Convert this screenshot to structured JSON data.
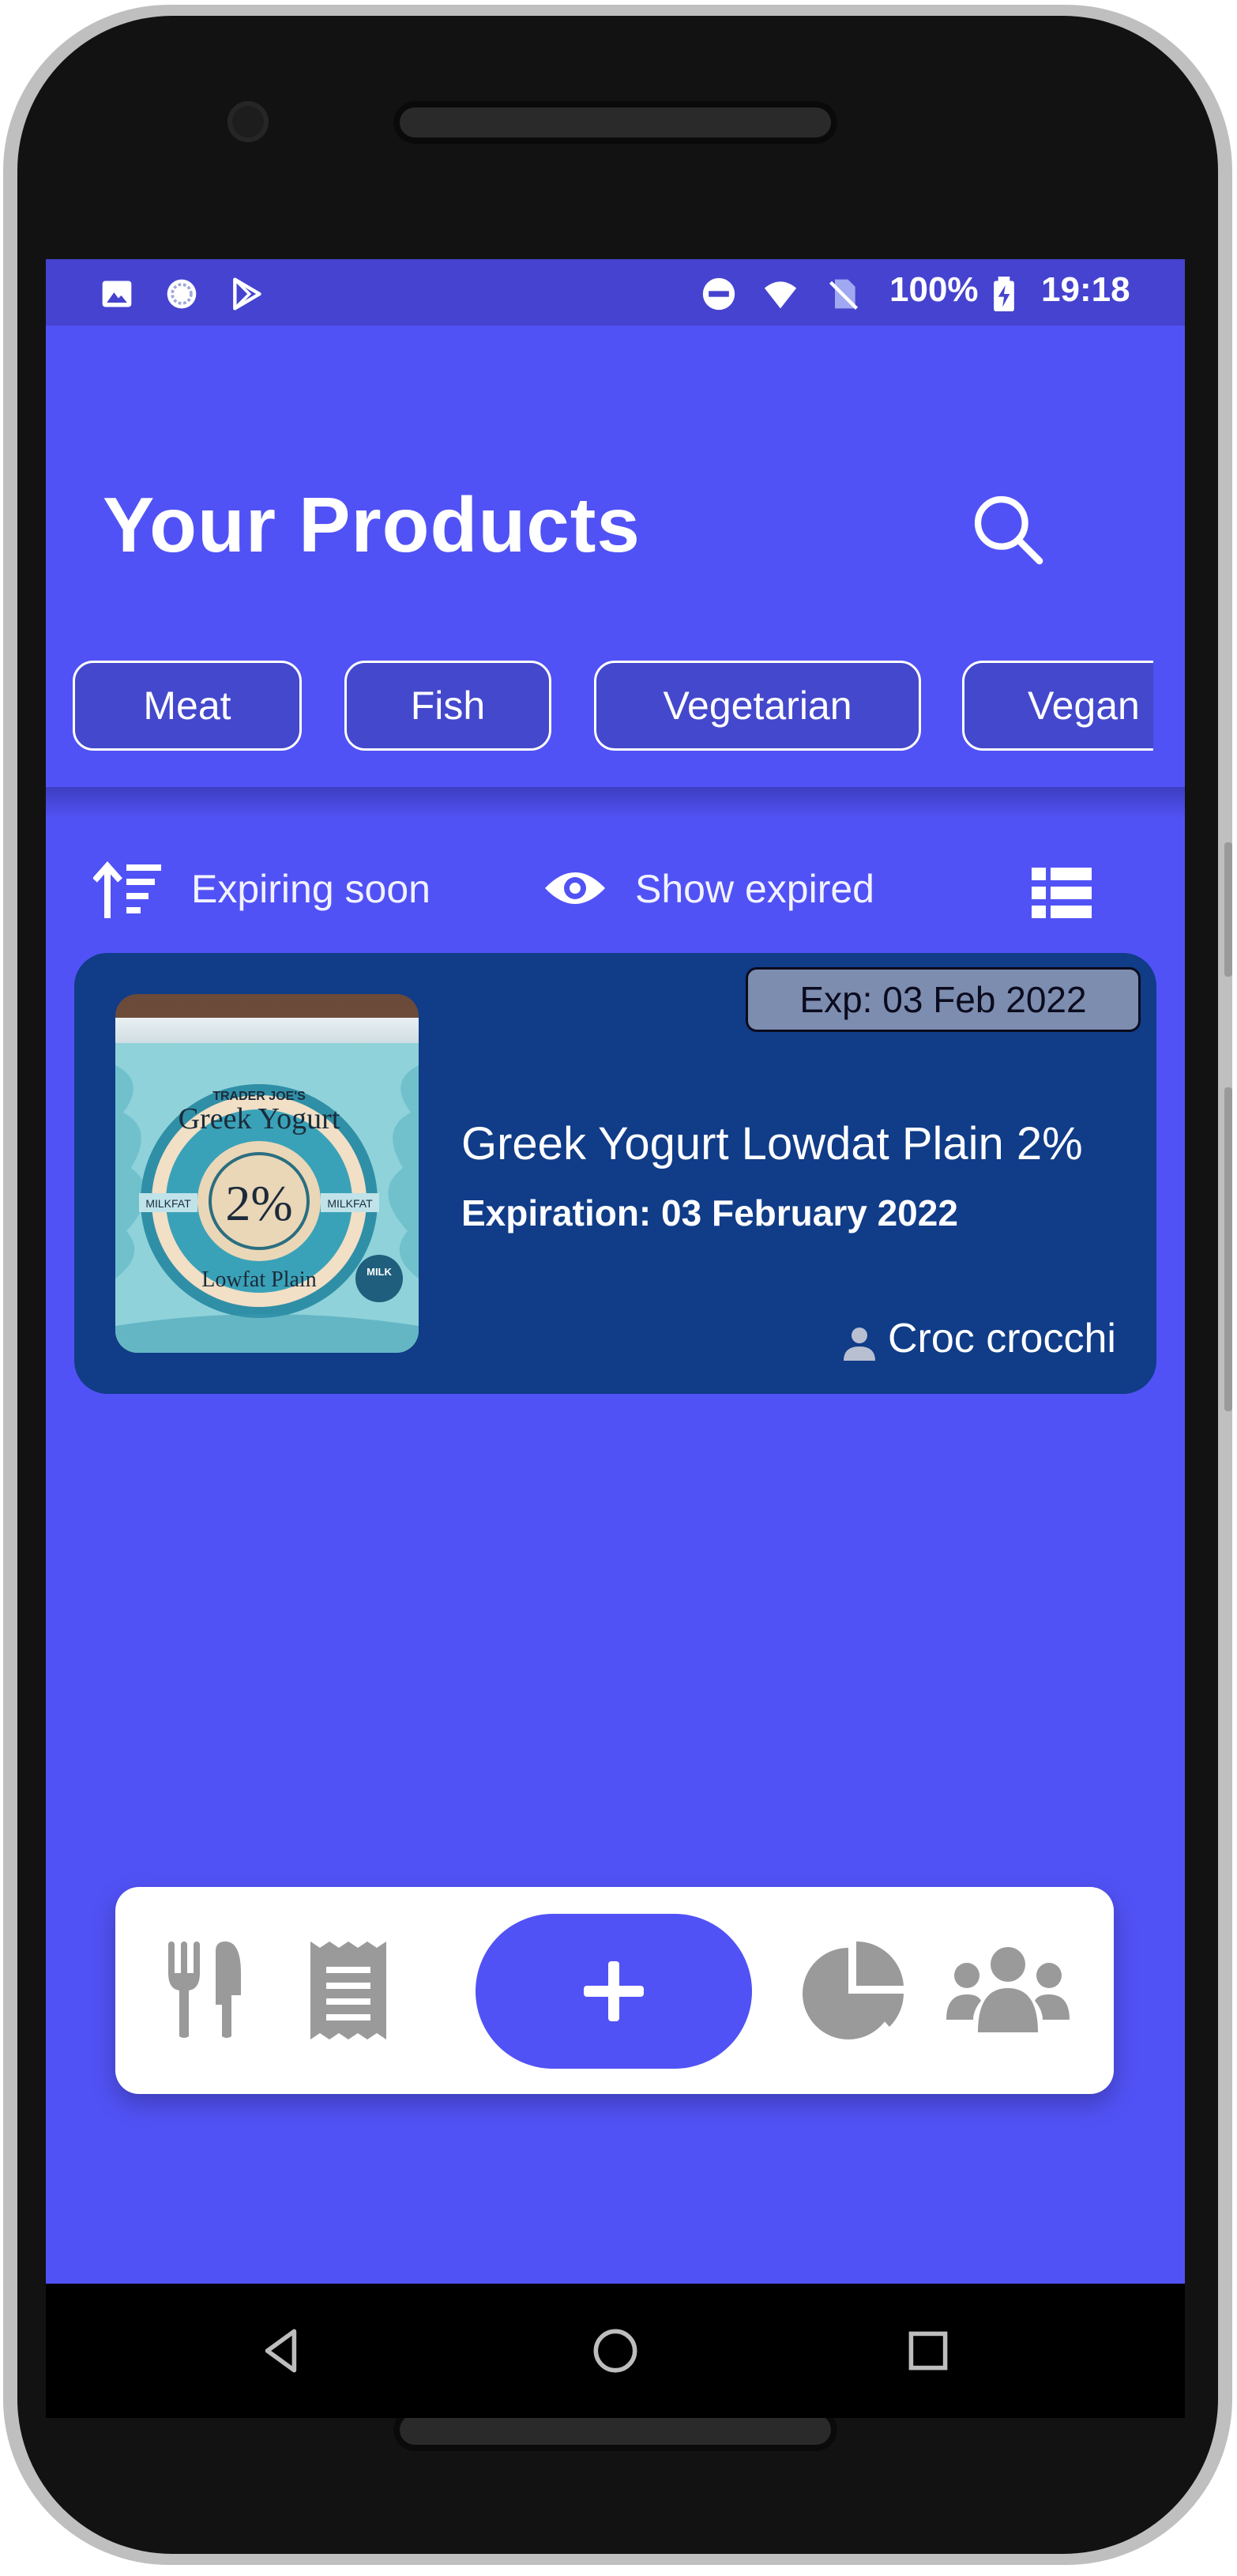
{
  "status_bar": {
    "battery": "100%",
    "time": "19:18"
  },
  "header": {
    "title": "Your Products"
  },
  "categories": [
    {
      "label": "Meat"
    },
    {
      "label": "Fish"
    },
    {
      "label": "Vegetarian"
    },
    {
      "label": "Vegan"
    }
  ],
  "toolbar": {
    "sort_label": "Expiring soon",
    "show_expired_label": "Show expired"
  },
  "products": [
    {
      "badge": "Exp: 03 Feb 2022",
      "name": "Greek Yogurt Lowdat Plain 2%",
      "expiration": "Expiration: 03 February 2022",
      "owner": "Croc crocchi",
      "image_text": {
        "brand": "TRADER JOE'S",
        "product": "Greek Yogurt",
        "percent": "2%",
        "subtitle": "Lowfat Plain",
        "left_tag": "MILKFAT",
        "right_tag": "MILKFAT",
        "seal": "MILK"
      }
    }
  ],
  "bottom_nav": {
    "add_label": "+"
  },
  "colors": {
    "accent": "#5152f5",
    "status_bar": "#4543cf",
    "card": "#103c88",
    "badge": "#7d8db0",
    "nav_icon": "#9a9a9a"
  }
}
